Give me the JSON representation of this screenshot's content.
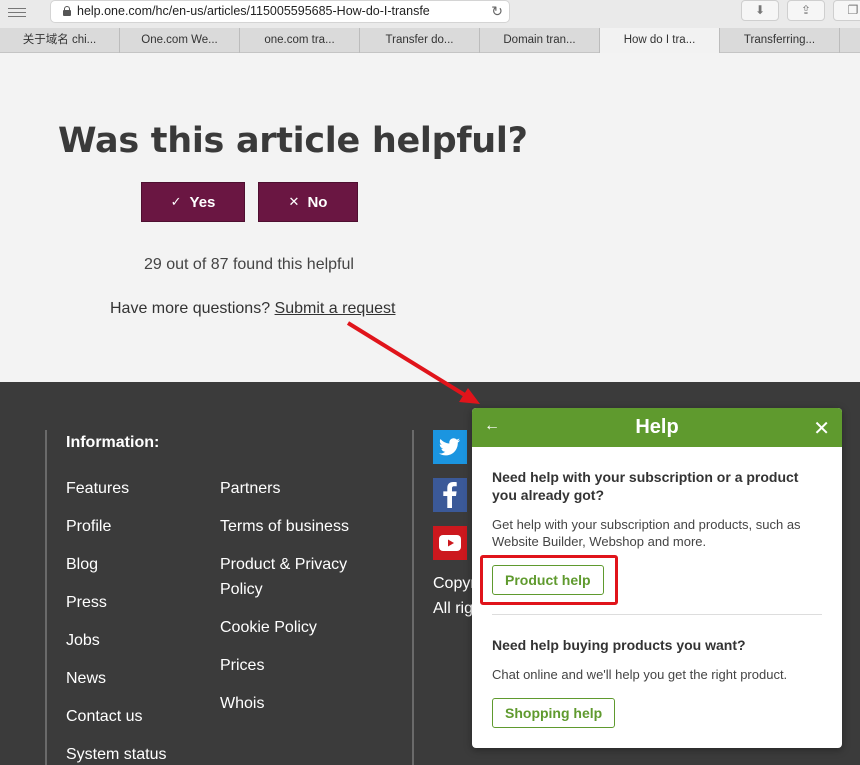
{
  "browser": {
    "url": "help.one.com/hc/en-us/articles/115005595685-How-do-I-transfe",
    "tabs": [
      "关于域名 chi...",
      "One.com We...",
      "one.com tra...",
      "Transfer do...",
      "Domain tran...",
      "How do I tra...",
      "Transferring..."
    ],
    "active_tab_index": 5
  },
  "feedback": {
    "title": "Was this article helpful?",
    "yes_label": "Yes",
    "no_label": "No",
    "count_text": "29 out of 87 found this helpful",
    "more_prefix": "Have more questions?",
    "more_link": "Submit a request"
  },
  "footer": {
    "info_title": "Information:",
    "col1": [
      "Features",
      "Profile",
      "Blog",
      "Press",
      "Jobs",
      "News",
      "Contact us",
      "System status"
    ],
    "col2": [
      "Partners",
      "Terms of business",
      "Product & Privacy Policy",
      "Cookie Policy",
      "Prices",
      "Whois"
    ],
    "copyright_line1": "Copyr",
    "copyright_line2": "All rig"
  },
  "help_widget": {
    "title": "Help",
    "section1_question": "Need help with your subscription or a product you already got?",
    "section1_text": "Get help with your subscription and products, such as Website Builder, Webshop and more.",
    "section1_button": "Product help",
    "section2_question": "Need help buying products you want?",
    "section2_text": "Chat online and we'll help you get the right product.",
    "section2_button": "Shopping help"
  },
  "colors": {
    "vote_button": "#6a1642",
    "widget_green": "#5f9a2e",
    "footer_bg": "#3b3b3b",
    "annotation_red": "#e0141b"
  }
}
